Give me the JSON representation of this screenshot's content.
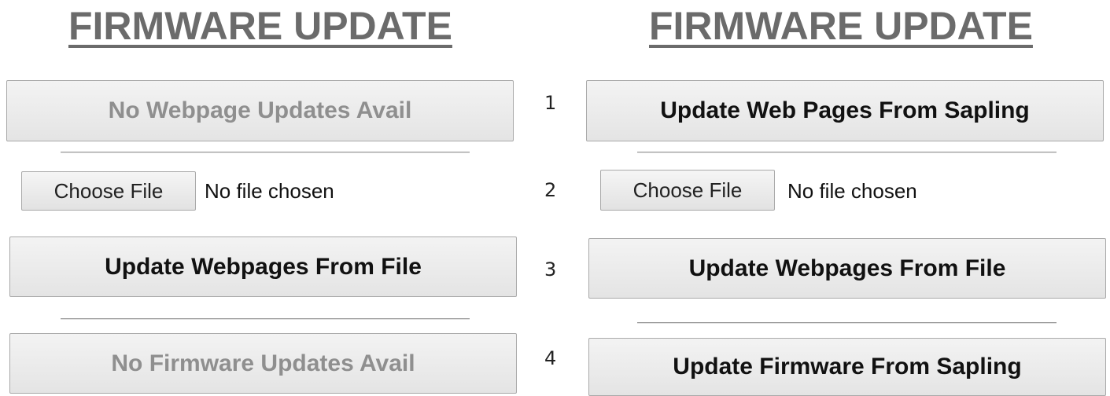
{
  "left_panel": {
    "title": "FIRMWARE UPDATE",
    "webpage_update_button": "No Webpage Updates Avail",
    "choose_file_button": "Choose File",
    "file_status": "No file chosen",
    "update_from_file_button": "Update Webpages From File",
    "firmware_update_button": "No Firmware Updates Avail"
  },
  "right_panel": {
    "title": "FIRMWARE UPDATE",
    "webpage_update_button": "Update Web Pages From Sapling",
    "choose_file_button": "Choose File",
    "file_status": "No file chosen",
    "update_from_file_button": "Update Webpages From File",
    "firmware_update_button": "Update Firmware From Sapling"
  },
  "step_numbers": [
    "1",
    "2",
    "3",
    "4"
  ],
  "colors": {
    "title_text": "#6b6b6b",
    "disabled_text": "#8f8f8f",
    "button_border": "#a9a9a9"
  }
}
